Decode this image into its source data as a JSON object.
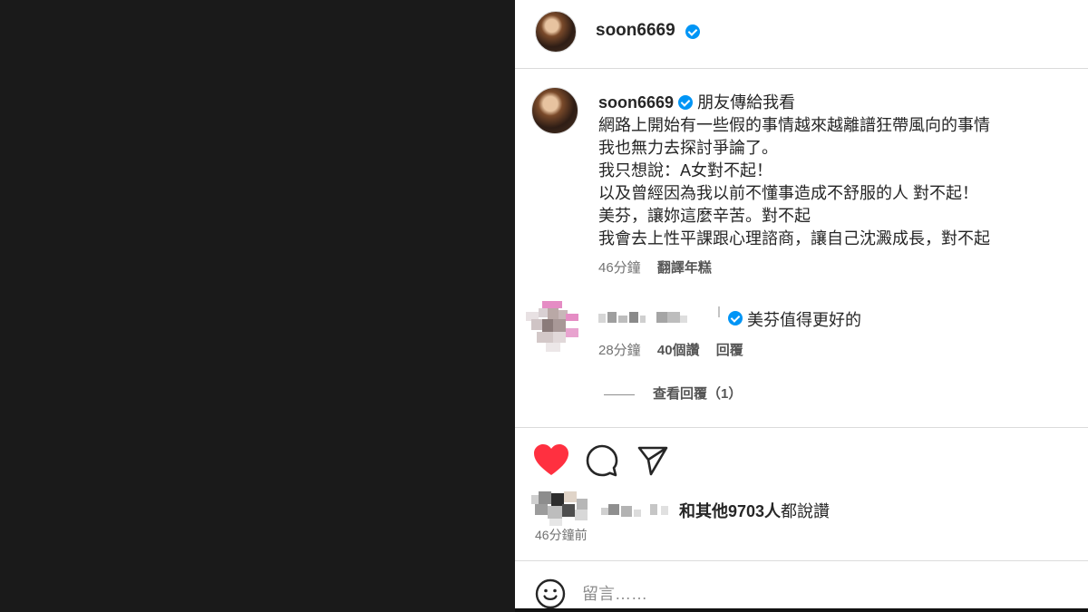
{
  "post": {
    "author": "soon6669",
    "caption_lines": [
      "朋友傳給我看",
      "網路上開始有一些假的事情越來越離譜狂帶風向的事情",
      "我也無力去探討爭論了。",
      "我只想說：A女對不起！",
      "以及曾經因為我以前不懂事造成不舒服的人 對不起！",
      "美芬，讓妳這麼辛苦。對不起",
      "我會去上性平課跟心理諮商，讓自己沈澱成長，對不起"
    ],
    "caption_time": "46分鐘",
    "translate_label": "翻譯年糕"
  },
  "comment": {
    "text": "美芬值得更好的",
    "time": "28分鐘",
    "likes": "40個讚",
    "reply_label": "回覆",
    "view_replies": "查看回覆（1）"
  },
  "likes": {
    "suffix": "和其他9703人",
    "verb": "都說讚",
    "time_ago": "46分鐘前"
  },
  "composer": {
    "placeholder": "留言……"
  },
  "icons": {
    "like": "heart-icon",
    "comment": "comment-icon",
    "share": "send-icon",
    "emoji": "emoji-icon",
    "verified": "verified-badge-icon"
  },
  "colors": {
    "like_red": "#ff3040",
    "verified_blue": "#0095f6",
    "muted_text": "#737373"
  }
}
